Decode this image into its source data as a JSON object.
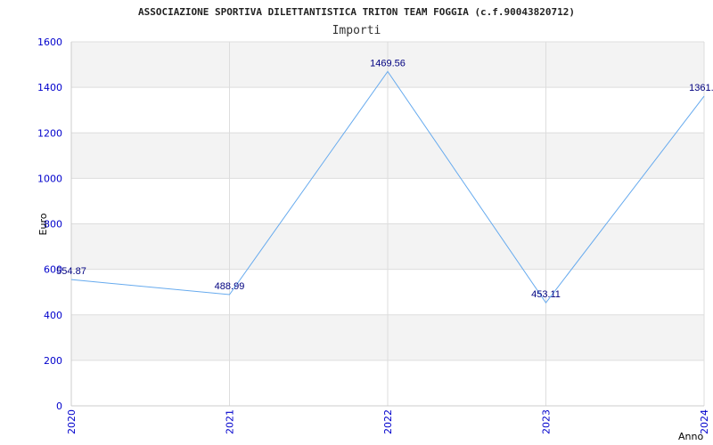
{
  "colors": {
    "band_fill": "#f3f3f3",
    "grid_line": "#dddddd",
    "axis_line": "#cccccc",
    "series_line": "#66aaee",
    "tick_text": "#0000cc",
    "data_label": "#000080"
  },
  "chart_data": {
    "type": "line",
    "title": "ASSOCIAZIONE SPORTIVA DILETTANTISTICA TRITON TEAM FOGGIA (c.f.90043820712)",
    "subtitle": "Importi",
    "xlabel": "Anno",
    "ylabel": "Euro",
    "ylim": [
      0,
      1600
    ],
    "yticks": [
      0,
      200,
      400,
      600,
      800,
      1000,
      1200,
      1400,
      1600
    ],
    "categories": [
      "2020",
      "2021",
      "2022",
      "2023",
      "2024"
    ],
    "values": [
      554.87,
      488.99,
      1469.56,
      453.11,
      1361.0
    ],
    "data_labels": [
      "554.87",
      "488.99",
      "1469.56",
      "453.11",
      "1361.0"
    ],
    "grid": true,
    "legend": "none"
  }
}
